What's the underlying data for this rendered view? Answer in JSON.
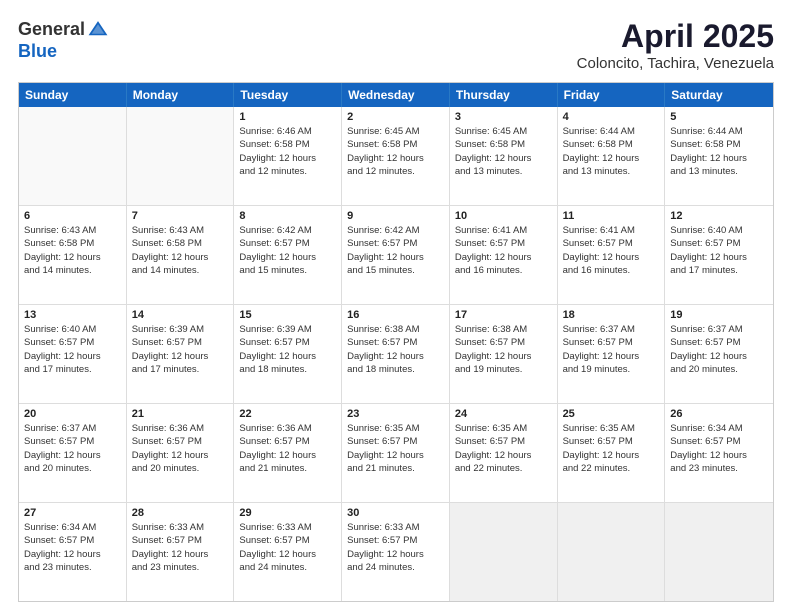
{
  "header": {
    "logo_line1": "General",
    "logo_line2": "Blue",
    "month_title": "April 2025",
    "location": "Coloncito, Tachira, Venezuela"
  },
  "days_of_week": [
    "Sunday",
    "Monday",
    "Tuesday",
    "Wednesday",
    "Thursday",
    "Friday",
    "Saturday"
  ],
  "weeks": [
    [
      {
        "day": "",
        "lines": [],
        "empty": true
      },
      {
        "day": "",
        "lines": [],
        "empty": true
      },
      {
        "day": "1",
        "lines": [
          "Sunrise: 6:46 AM",
          "Sunset: 6:58 PM",
          "Daylight: 12 hours",
          "and 12 minutes."
        ]
      },
      {
        "day": "2",
        "lines": [
          "Sunrise: 6:45 AM",
          "Sunset: 6:58 PM",
          "Daylight: 12 hours",
          "and 12 minutes."
        ]
      },
      {
        "day": "3",
        "lines": [
          "Sunrise: 6:45 AM",
          "Sunset: 6:58 PM",
          "Daylight: 12 hours",
          "and 13 minutes."
        ]
      },
      {
        "day": "4",
        "lines": [
          "Sunrise: 6:44 AM",
          "Sunset: 6:58 PM",
          "Daylight: 12 hours",
          "and 13 minutes."
        ]
      },
      {
        "day": "5",
        "lines": [
          "Sunrise: 6:44 AM",
          "Sunset: 6:58 PM",
          "Daylight: 12 hours",
          "and 13 minutes."
        ]
      }
    ],
    [
      {
        "day": "6",
        "lines": [
          "Sunrise: 6:43 AM",
          "Sunset: 6:58 PM",
          "Daylight: 12 hours",
          "and 14 minutes."
        ]
      },
      {
        "day": "7",
        "lines": [
          "Sunrise: 6:43 AM",
          "Sunset: 6:58 PM",
          "Daylight: 12 hours",
          "and 14 minutes."
        ]
      },
      {
        "day": "8",
        "lines": [
          "Sunrise: 6:42 AM",
          "Sunset: 6:57 PM",
          "Daylight: 12 hours",
          "and 15 minutes."
        ]
      },
      {
        "day": "9",
        "lines": [
          "Sunrise: 6:42 AM",
          "Sunset: 6:57 PM",
          "Daylight: 12 hours",
          "and 15 minutes."
        ]
      },
      {
        "day": "10",
        "lines": [
          "Sunrise: 6:41 AM",
          "Sunset: 6:57 PM",
          "Daylight: 12 hours",
          "and 16 minutes."
        ]
      },
      {
        "day": "11",
        "lines": [
          "Sunrise: 6:41 AM",
          "Sunset: 6:57 PM",
          "Daylight: 12 hours",
          "and 16 minutes."
        ]
      },
      {
        "day": "12",
        "lines": [
          "Sunrise: 6:40 AM",
          "Sunset: 6:57 PM",
          "Daylight: 12 hours",
          "and 17 minutes."
        ]
      }
    ],
    [
      {
        "day": "13",
        "lines": [
          "Sunrise: 6:40 AM",
          "Sunset: 6:57 PM",
          "Daylight: 12 hours",
          "and 17 minutes."
        ]
      },
      {
        "day": "14",
        "lines": [
          "Sunrise: 6:39 AM",
          "Sunset: 6:57 PM",
          "Daylight: 12 hours",
          "and 17 minutes."
        ]
      },
      {
        "day": "15",
        "lines": [
          "Sunrise: 6:39 AM",
          "Sunset: 6:57 PM",
          "Daylight: 12 hours",
          "and 18 minutes."
        ]
      },
      {
        "day": "16",
        "lines": [
          "Sunrise: 6:38 AM",
          "Sunset: 6:57 PM",
          "Daylight: 12 hours",
          "and 18 minutes."
        ]
      },
      {
        "day": "17",
        "lines": [
          "Sunrise: 6:38 AM",
          "Sunset: 6:57 PM",
          "Daylight: 12 hours",
          "and 19 minutes."
        ]
      },
      {
        "day": "18",
        "lines": [
          "Sunrise: 6:37 AM",
          "Sunset: 6:57 PM",
          "Daylight: 12 hours",
          "and 19 minutes."
        ]
      },
      {
        "day": "19",
        "lines": [
          "Sunrise: 6:37 AM",
          "Sunset: 6:57 PM",
          "Daylight: 12 hours",
          "and 20 minutes."
        ]
      }
    ],
    [
      {
        "day": "20",
        "lines": [
          "Sunrise: 6:37 AM",
          "Sunset: 6:57 PM",
          "Daylight: 12 hours",
          "and 20 minutes."
        ]
      },
      {
        "day": "21",
        "lines": [
          "Sunrise: 6:36 AM",
          "Sunset: 6:57 PM",
          "Daylight: 12 hours",
          "and 20 minutes."
        ]
      },
      {
        "day": "22",
        "lines": [
          "Sunrise: 6:36 AM",
          "Sunset: 6:57 PM",
          "Daylight: 12 hours",
          "and 21 minutes."
        ]
      },
      {
        "day": "23",
        "lines": [
          "Sunrise: 6:35 AM",
          "Sunset: 6:57 PM",
          "Daylight: 12 hours",
          "and 21 minutes."
        ]
      },
      {
        "day": "24",
        "lines": [
          "Sunrise: 6:35 AM",
          "Sunset: 6:57 PM",
          "Daylight: 12 hours",
          "and 22 minutes."
        ]
      },
      {
        "day": "25",
        "lines": [
          "Sunrise: 6:35 AM",
          "Sunset: 6:57 PM",
          "Daylight: 12 hours",
          "and 22 minutes."
        ]
      },
      {
        "day": "26",
        "lines": [
          "Sunrise: 6:34 AM",
          "Sunset: 6:57 PM",
          "Daylight: 12 hours",
          "and 23 minutes."
        ]
      }
    ],
    [
      {
        "day": "27",
        "lines": [
          "Sunrise: 6:34 AM",
          "Sunset: 6:57 PM",
          "Daylight: 12 hours",
          "and 23 minutes."
        ]
      },
      {
        "day": "28",
        "lines": [
          "Sunrise: 6:33 AM",
          "Sunset: 6:57 PM",
          "Daylight: 12 hours",
          "and 23 minutes."
        ]
      },
      {
        "day": "29",
        "lines": [
          "Sunrise: 6:33 AM",
          "Sunset: 6:57 PM",
          "Daylight: 12 hours",
          "and 24 minutes."
        ]
      },
      {
        "day": "30",
        "lines": [
          "Sunrise: 6:33 AM",
          "Sunset: 6:57 PM",
          "Daylight: 12 hours",
          "and 24 minutes."
        ]
      },
      {
        "day": "",
        "lines": [],
        "empty": true,
        "shaded": true
      },
      {
        "day": "",
        "lines": [],
        "empty": true,
        "shaded": true
      },
      {
        "day": "",
        "lines": [],
        "empty": true,
        "shaded": true
      }
    ]
  ]
}
